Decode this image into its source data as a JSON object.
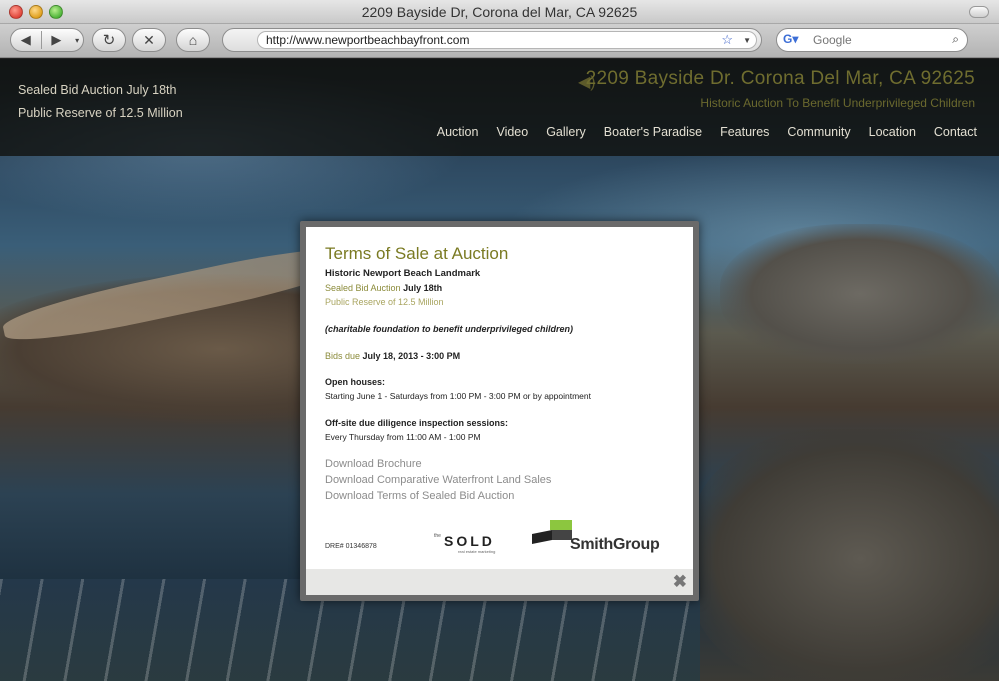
{
  "window": {
    "title": "2209 Bayside Dr, Corona del Mar, CA 92625"
  },
  "toolbar": {
    "back_icon": "back-arrow-icon",
    "forward_icon": "forward-arrow-icon",
    "reload_icon": "reload-icon",
    "stop_icon": "stop-icon",
    "home_icon": "home-icon",
    "url": "http://www.newportbeachbayfront.com",
    "search_placeholder": "Google"
  },
  "header": {
    "left_line1": "Sealed Bid Auction July 18th",
    "left_line2": "Public Reserve of 12.5 Million",
    "title": "2209 Bayside Dr. Corona Del Mar, CA 92625",
    "subtitle": "Historic Auction To Benefit Underprivileged Children",
    "nav": [
      "Auction",
      "Video",
      "Gallery",
      "Boater's Paradise",
      "Features",
      "Community",
      "Location",
      "Contact"
    ]
  },
  "modal": {
    "title": "Terms of Sale at Auction",
    "subtitle": "Historic Newport Beach Landmark",
    "auction_prefix": "Sealed Bid Auction",
    "auction_date": "July 18th",
    "reserve": "Public Reserve of 12.5 Million",
    "charity": "(charitable foundation to benefit underprivileged children)",
    "bids_prefix": "Bids due",
    "bids_date": "July 18, 2013 - 3:00 PM",
    "open_houses_label": "Open houses:",
    "open_houses_text": "Starting June 1 - Saturdays from 1:00 PM - 3:00 PM or by appointment",
    "diligence_label": "Off-site due diligence inspection sessions:",
    "diligence_text": "Every Thursday from 11:00 AM - 1:00 PM",
    "links": [
      "Download Brochure",
      "Download Comparative Waterfront Land Sales",
      "Download Terms of Sealed Bid Auction"
    ],
    "dre": "DRE# 01346878",
    "sold_logo": {
      "the": "the",
      "word": "SOLD",
      "tagline": "real estate marketing"
    },
    "smith_logo": "SmithGroup",
    "close": "✖"
  },
  "colors": {
    "accent_olive": "#7a7a22",
    "header_bg": "#0f0f0c"
  }
}
